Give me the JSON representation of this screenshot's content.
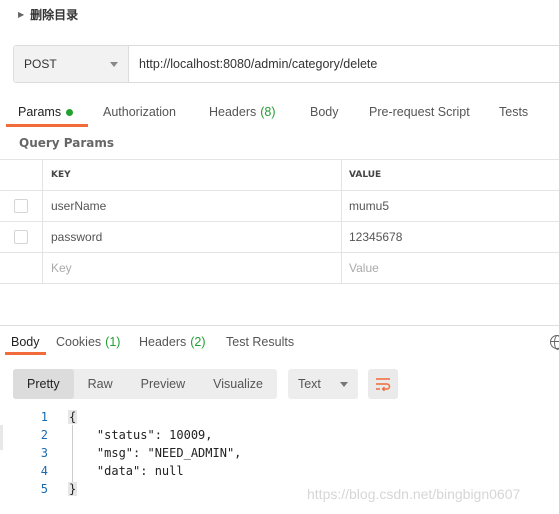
{
  "request": {
    "title": "删除目录",
    "method": "POST",
    "url": "http://localhost:8080/admin/category/delete"
  },
  "request_tabs": {
    "params": "Params",
    "authorization": "Authorization",
    "headers": "Headers",
    "headers_count": "(8)",
    "body": "Body",
    "prerequest": "Pre-request Script",
    "tests": "Tests"
  },
  "query_params": {
    "label": "Query Params",
    "col_key": "KEY",
    "col_value": "VALUE",
    "rows": [
      {
        "key": "userName",
        "value": "mumu5"
      },
      {
        "key": "password",
        "value": "12345678"
      }
    ],
    "key_placeholder": "Key",
    "value_placeholder": "Value"
  },
  "response_tabs": {
    "body": "Body",
    "cookies": "Cookies",
    "cookies_count": "(1)",
    "headers": "Headers",
    "headers_count": "(2)",
    "test_results": "Test Results"
  },
  "view_modes": {
    "pretty": "Pretty",
    "raw": "Raw",
    "preview": "Preview",
    "visualize": "Visualize",
    "format": "Text"
  },
  "response_lines": [
    {
      "num": "1",
      "text": "{"
    },
    {
      "num": "2",
      "text": "    \"status\": 10009,"
    },
    {
      "num": "3",
      "text": "    \"msg\": \"NEED_ADMIN\","
    },
    {
      "num": "4",
      "text": "    \"data\": null"
    },
    {
      "num": "5",
      "text": "}"
    }
  ],
  "watermark": "https://blog.csdn.net/bingbign0607",
  "colors": {
    "accent": "#f26b3a",
    "count_green": "#22a032",
    "line_number": "#1a6bb0"
  },
  "icons": [
    "caret-right-icon",
    "chevron-down-icon",
    "status-dot-icon",
    "globe-icon",
    "wrap-lines-icon"
  ]
}
